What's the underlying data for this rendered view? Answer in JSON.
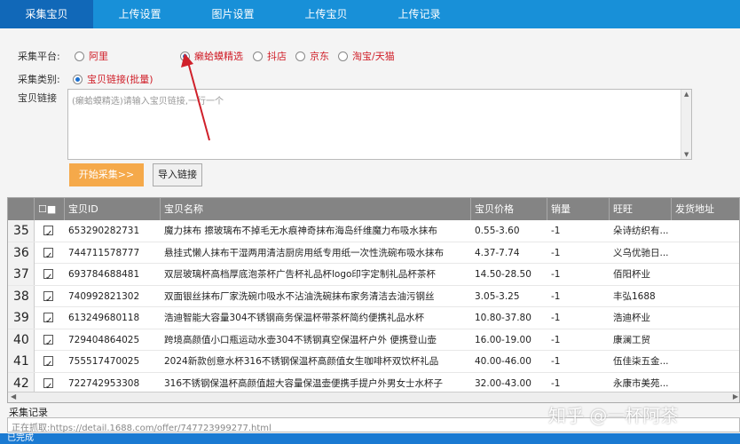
{
  "tabs": [
    "采集宝贝",
    "上传设置",
    "图片设置",
    "上传宝贝",
    "上传记录"
  ],
  "form": {
    "platform_label": "采集平台:",
    "platforms": [
      {
        "label": "阿里",
        "checked": false
      },
      {
        "label": "癞蛤蟆精选",
        "checked": true
      },
      {
        "label": "抖店",
        "checked": false
      },
      {
        "label": "京东",
        "checked": false
      },
      {
        "label": "淘宝/天猫",
        "checked": false
      }
    ],
    "category_label": "采集类别:",
    "category_option": "宝贝链接(批量)",
    "link_label": "宝贝链接",
    "link_placeholder": "(癞蛤蟆精选)请输入宝贝链接,一行一个",
    "start_button": "开始采集>>",
    "import_button": "导入链接"
  },
  "table": {
    "headers": [
      "",
      "宝贝ID",
      "宝贝名称",
      "宝贝价格",
      "销量",
      "旺旺",
      "发货地址"
    ],
    "rows": [
      {
        "num": "35",
        "id": "653290282731",
        "name": "魔力抹布 擦玻璃布不掉毛无水痕神奇抹布海岛纤维魔力布吸水抹布",
        "price": "0.55-3.60",
        "sales": "-1",
        "wangwang": "朵诗纺织有..."
      },
      {
        "num": "36",
        "id": "744711578777",
        "name": "悬挂式懒人抹布干湿两用清洁厨房用纸专用纸一次性洗碗布吸水抹布",
        "price": "4.37-7.74",
        "sales": "-1",
        "wangwang": "义乌优驰日..."
      },
      {
        "num": "37",
        "id": "693784688481",
        "name": "双层玻璃杯高档厚底泡茶杯广告杯礼品杯logo印字定制礼品杯茶杯",
        "price": "14.50-28.50",
        "sales": "-1",
        "wangwang": "佰阳杯业"
      },
      {
        "num": "38",
        "id": "740992821302",
        "name": "双面银丝抹布厂家洗碗巾吸水不沾油洗碗抹布家务清洁去油污钢丝",
        "price": "3.05-3.25",
        "sales": "-1",
        "wangwang": "丰弘1688"
      },
      {
        "num": "39",
        "id": "613249680118",
        "name": "浩迪智能大容量304不锈钢商务保温杯带茶杯简约便携礼品水杯",
        "price": "10.80-37.80",
        "sales": "-1",
        "wangwang": "浩迪杯业"
      },
      {
        "num": "40",
        "id": "729404864025",
        "name": "跨境高颜值小口瓶运动水壶304不锈钢真空保温杯户外 便携登山壶",
        "price": "16.00-19.00",
        "sales": "-1",
        "wangwang": "康澜工贸"
      },
      {
        "num": "41",
        "id": "755517470025",
        "name": "2024新款创意水杯316不锈钢保温杯高颜值女生咖啡杯双饮杯礼品",
        "price": "40.00-46.00",
        "sales": "-1",
        "wangwang": "伍佳柒五金..."
      },
      {
        "num": "42",
        "id": "722742953308",
        "name": "316不锈钢保温杯高颜值超大容量保温壶便携手提户外男女士水杯子",
        "price": "32.00-43.00",
        "sales": "-1",
        "wangwang": "永康市美苑..."
      }
    ]
  },
  "log": {
    "label": "采集记录",
    "line": "正在抓取:https://detail.1688.com/offer/747723999277.html"
  },
  "status": "已完成",
  "watermark": "知乎 @一杯阿茶"
}
